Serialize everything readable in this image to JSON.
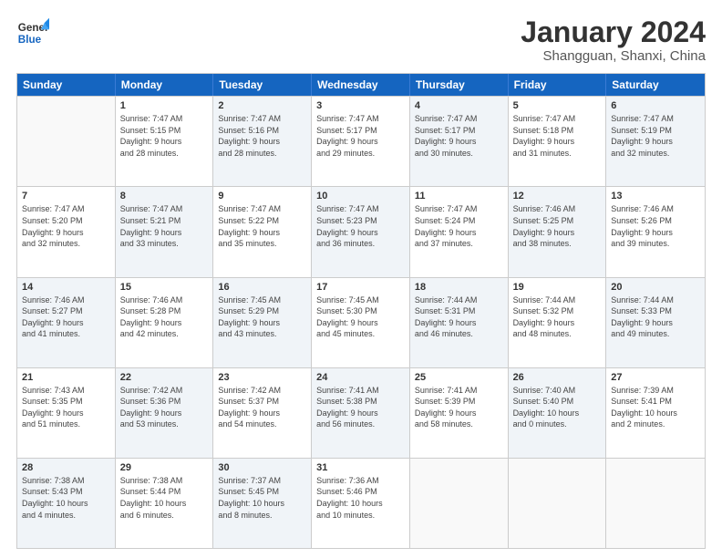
{
  "header": {
    "logo_general": "General",
    "logo_blue": "Blue",
    "month_title": "January 2024",
    "location": "Shangguan, Shanxi, China"
  },
  "weekdays": [
    "Sunday",
    "Monday",
    "Tuesday",
    "Wednesday",
    "Thursday",
    "Friday",
    "Saturday"
  ],
  "rows": [
    [
      {
        "day": "",
        "info": "",
        "shaded": false,
        "empty": true
      },
      {
        "day": "1",
        "info": "Sunrise: 7:47 AM\nSunset: 5:15 PM\nDaylight: 9 hours\nand 28 minutes.",
        "shaded": false
      },
      {
        "day": "2",
        "info": "Sunrise: 7:47 AM\nSunset: 5:16 PM\nDaylight: 9 hours\nand 28 minutes.",
        "shaded": true
      },
      {
        "day": "3",
        "info": "Sunrise: 7:47 AM\nSunset: 5:17 PM\nDaylight: 9 hours\nand 29 minutes.",
        "shaded": false
      },
      {
        "day": "4",
        "info": "Sunrise: 7:47 AM\nSunset: 5:17 PM\nDaylight: 9 hours\nand 30 minutes.",
        "shaded": true
      },
      {
        "day": "5",
        "info": "Sunrise: 7:47 AM\nSunset: 5:18 PM\nDaylight: 9 hours\nand 31 minutes.",
        "shaded": false
      },
      {
        "day": "6",
        "info": "Sunrise: 7:47 AM\nSunset: 5:19 PM\nDaylight: 9 hours\nand 32 minutes.",
        "shaded": true
      }
    ],
    [
      {
        "day": "7",
        "info": "Sunrise: 7:47 AM\nSunset: 5:20 PM\nDaylight: 9 hours\nand 32 minutes.",
        "shaded": false
      },
      {
        "day": "8",
        "info": "Sunrise: 7:47 AM\nSunset: 5:21 PM\nDaylight: 9 hours\nand 33 minutes.",
        "shaded": true
      },
      {
        "day": "9",
        "info": "Sunrise: 7:47 AM\nSunset: 5:22 PM\nDaylight: 9 hours\nand 35 minutes.",
        "shaded": false
      },
      {
        "day": "10",
        "info": "Sunrise: 7:47 AM\nSunset: 5:23 PM\nDaylight: 9 hours\nand 36 minutes.",
        "shaded": true
      },
      {
        "day": "11",
        "info": "Sunrise: 7:47 AM\nSunset: 5:24 PM\nDaylight: 9 hours\nand 37 minutes.",
        "shaded": false
      },
      {
        "day": "12",
        "info": "Sunrise: 7:46 AM\nSunset: 5:25 PM\nDaylight: 9 hours\nand 38 minutes.",
        "shaded": true
      },
      {
        "day": "13",
        "info": "Sunrise: 7:46 AM\nSunset: 5:26 PM\nDaylight: 9 hours\nand 39 minutes.",
        "shaded": false
      }
    ],
    [
      {
        "day": "14",
        "info": "Sunrise: 7:46 AM\nSunset: 5:27 PM\nDaylight: 9 hours\nand 41 minutes.",
        "shaded": true
      },
      {
        "day": "15",
        "info": "Sunrise: 7:46 AM\nSunset: 5:28 PM\nDaylight: 9 hours\nand 42 minutes.",
        "shaded": false
      },
      {
        "day": "16",
        "info": "Sunrise: 7:45 AM\nSunset: 5:29 PM\nDaylight: 9 hours\nand 43 minutes.",
        "shaded": true
      },
      {
        "day": "17",
        "info": "Sunrise: 7:45 AM\nSunset: 5:30 PM\nDaylight: 9 hours\nand 45 minutes.",
        "shaded": false
      },
      {
        "day": "18",
        "info": "Sunrise: 7:44 AM\nSunset: 5:31 PM\nDaylight: 9 hours\nand 46 minutes.",
        "shaded": true
      },
      {
        "day": "19",
        "info": "Sunrise: 7:44 AM\nSunset: 5:32 PM\nDaylight: 9 hours\nand 48 minutes.",
        "shaded": false
      },
      {
        "day": "20",
        "info": "Sunrise: 7:44 AM\nSunset: 5:33 PM\nDaylight: 9 hours\nand 49 minutes.",
        "shaded": true
      }
    ],
    [
      {
        "day": "21",
        "info": "Sunrise: 7:43 AM\nSunset: 5:35 PM\nDaylight: 9 hours\nand 51 minutes.",
        "shaded": false
      },
      {
        "day": "22",
        "info": "Sunrise: 7:42 AM\nSunset: 5:36 PM\nDaylight: 9 hours\nand 53 minutes.",
        "shaded": true
      },
      {
        "day": "23",
        "info": "Sunrise: 7:42 AM\nSunset: 5:37 PM\nDaylight: 9 hours\nand 54 minutes.",
        "shaded": false
      },
      {
        "day": "24",
        "info": "Sunrise: 7:41 AM\nSunset: 5:38 PM\nDaylight: 9 hours\nand 56 minutes.",
        "shaded": true
      },
      {
        "day": "25",
        "info": "Sunrise: 7:41 AM\nSunset: 5:39 PM\nDaylight: 9 hours\nand 58 minutes.",
        "shaded": false
      },
      {
        "day": "26",
        "info": "Sunrise: 7:40 AM\nSunset: 5:40 PM\nDaylight: 10 hours\nand 0 minutes.",
        "shaded": true
      },
      {
        "day": "27",
        "info": "Sunrise: 7:39 AM\nSunset: 5:41 PM\nDaylight: 10 hours\nand 2 minutes.",
        "shaded": false
      }
    ],
    [
      {
        "day": "28",
        "info": "Sunrise: 7:38 AM\nSunset: 5:43 PM\nDaylight: 10 hours\nand 4 minutes.",
        "shaded": true
      },
      {
        "day": "29",
        "info": "Sunrise: 7:38 AM\nSunset: 5:44 PM\nDaylight: 10 hours\nand 6 minutes.",
        "shaded": false
      },
      {
        "day": "30",
        "info": "Sunrise: 7:37 AM\nSunset: 5:45 PM\nDaylight: 10 hours\nand 8 minutes.",
        "shaded": true
      },
      {
        "day": "31",
        "info": "Sunrise: 7:36 AM\nSunset: 5:46 PM\nDaylight: 10 hours\nand 10 minutes.",
        "shaded": false
      },
      {
        "day": "",
        "info": "",
        "shaded": false,
        "empty": true
      },
      {
        "day": "",
        "info": "",
        "shaded": false,
        "empty": true
      },
      {
        "day": "",
        "info": "",
        "shaded": false,
        "empty": true
      }
    ]
  ]
}
